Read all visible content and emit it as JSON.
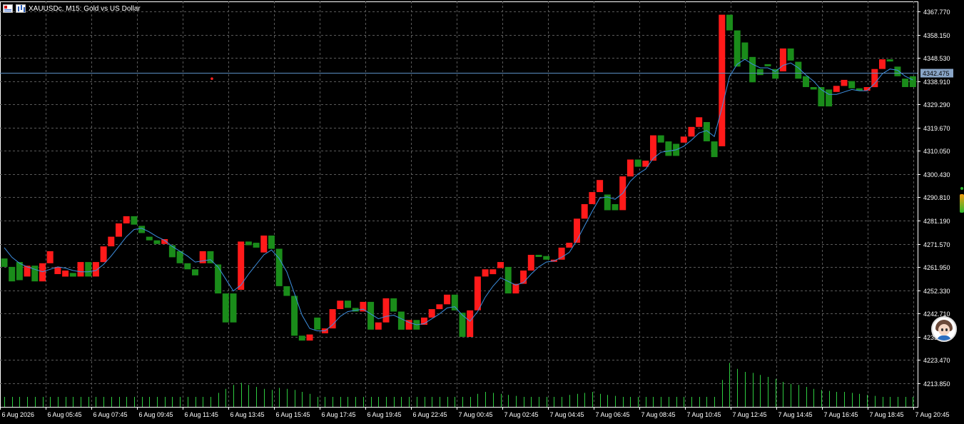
{
  "window": {
    "title": "XAUUSDc, M15:  Gold vs US Dollar"
  },
  "colors": {
    "background": "#000000",
    "grid": "#5a5a5a",
    "bull_candle": "#ff1a1a",
    "bear_candle": "#1a8c1a",
    "ma_line": "#3d8fe0",
    "bid_line": "#5b8fc4",
    "volume": "#2ecc40",
    "axis_text": "#ffffff"
  },
  "chart_data": {
    "type": "bar",
    "symbol": "XAUUSDc",
    "timeframe": "M15",
    "ylim": [
      4204.0,
      4372.0
    ],
    "y_ticks": [
      "4367.770",
      "4358.150",
      "4348.530",
      "4338.910",
      "4329.290",
      "4319.670",
      "4310.050",
      "4300.430",
      "4290.810",
      "4281.190",
      "4271.570",
      "4261.950",
      "4252.330",
      "4242.710",
      "4233.090",
      "4223.470",
      "4213.850"
    ],
    "x_ticks": [
      "6 Aug 2026",
      "6 Aug 05:45",
      "6 Aug 07:45",
      "6 Aug 09:45",
      "6 Aug 11:45",
      "6 Aug 13:45",
      "6 Aug 15:45",
      "6 Aug 17:45",
      "6 Aug 19:45",
      "6 Aug 22:45",
      "7 Aug 00:45",
      "7 Aug 02:45",
      "7 Aug 04:45",
      "7 Aug 06:45",
      "7 Aug 08:45",
      "7 Aug 10:45",
      "7 Aug 12:45",
      "7 Aug 14:45",
      "7 Aug 16:45",
      "7 Aug 18:45",
      "7 Aug 20:45"
    ],
    "current_price": "4342.475",
    "current_price_value": 4342.475,
    "red_marker_price": 4340.0,
    "candles": [
      [
        4265.5,
        4262.0
      ],
      [
        4262.0,
        4256.0
      ],
      [
        4264.0,
        4256.5
      ],
      [
        4258.0,
        4262.5
      ],
      [
        4262.5,
        4256.0
      ],
      [
        4256.0,
        4263.5
      ],
      [
        4263.5,
        4268.5
      ],
      [
        4259.0,
        4262.0
      ],
      [
        4258.0,
        4260.5
      ],
      [
        4259.5,
        4258.0
      ],
      [
        4258.0,
        4264.0
      ],
      [
        4264.0,
        4258.0
      ],
      [
        4258.0,
        4264.0
      ],
      [
        4264.0,
        4270.5
      ],
      [
        4270.5,
        4274.5
      ],
      [
        4274.5,
        4280.0
      ],
      [
        4280.0,
        4283.0
      ],
      [
        4283.0,
        4279.5
      ],
      [
        4279.0,
        4276.0
      ],
      [
        4274.5,
        4273.0
      ],
      [
        4273.0,
        4271.5
      ],
      [
        4271.5,
        4273.5
      ],
      [
        4271.0,
        4266.0
      ],
      [
        4268.5,
        4263.5
      ],
      [
        4263.5,
        4261.0
      ],
      [
        4261.0,
        4258.5
      ],
      [
        4263.5,
        4268.5
      ],
      [
        4268.5,
        4263.5
      ],
      [
        4263.0,
        4251.0
      ],
      [
        4251.0,
        4239.0
      ],
      [
        4251.0,
        4239.0
      ],
      [
        4252.5,
        4272.5
      ],
      [
        4272.5,
        4271.0
      ],
      [
        4272.0,
        4270.0
      ],
      [
        4268.0,
        4275.0
      ],
      [
        4275.0,
        4269.5
      ],
      [
        4269.5,
        4254.0
      ],
      [
        4254.0,
        4250.0
      ],
      [
        4250.0,
        4233.5
      ],
      [
        4233.5,
        4231.5
      ],
      [
        4231.5,
        4234.0
      ],
      [
        4241.0,
        4236.0
      ],
      [
        4234.5,
        4236.5
      ],
      [
        4236.5,
        4244.5
      ],
      [
        4244.5,
        4248.0
      ],
      [
        4248.0,
        4245.0
      ],
      [
        4245.0,
        4243.5
      ],
      [
        4243.5,
        4247.5
      ],
      [
        4247.5,
        4236.0
      ],
      [
        4236.0,
        4239.0
      ],
      [
        4239.0,
        4249.0
      ],
      [
        4249.0,
        4243.5
      ],
      [
        4243.5,
        4236.0
      ],
      [
        4236.0,
        4240.0
      ],
      [
        4240.0,
        4236.0
      ],
      [
        4238.0,
        4241.0
      ],
      [
        4241.0,
        4244.5
      ],
      [
        4244.5,
        4246.5
      ],
      [
        4246.5,
        4250.5
      ],
      [
        4250.5,
        4244.0
      ],
      [
        4243.0,
        4233.0
      ],
      [
        4233.0,
        4244.0
      ],
      [
        4244.0,
        4258.0
      ],
      [
        4258.0,
        4261.0
      ],
      [
        4259.0,
        4261.0
      ],
      [
        4261.5,
        4264.0
      ],
      [
        4262.0,
        4251.0
      ],
      [
        4251.0,
        4255.0
      ],
      [
        4255.0,
        4260.5
      ],
      [
        4260.5,
        4267.0
      ],
      [
        4267.0,
        4266.5
      ],
      [
        4266.5,
        4265.0
      ],
      [
        4265.0,
        4265.0
      ],
      [
        4265.0,
        4270.0
      ],
      [
        4270.0,
        4272.0
      ],
      [
        4272.0,
        4282.0
      ],
      [
        4282.0,
        4288.0
      ],
      [
        4288.0,
        4293.0
      ],
      [
        4293.0,
        4298.0
      ],
      [
        4292.0,
        4285.5
      ],
      [
        4288.0,
        4285.5
      ],
      [
        4285.5,
        4299.5
      ],
      [
        4299.5,
        4306.5
      ],
      [
        4306.5,
        4303.5
      ],
      [
        4303.5,
        4306.0
      ],
      [
        4306.0,
        4316.5
      ],
      [
        4316.5,
        4313.5
      ],
      [
        4314.0,
        4308.0
      ],
      [
        4313.0,
        4308.0
      ],
      [
        4313.5,
        4316.0
      ],
      [
        4316.0,
        4320.0
      ],
      [
        4320.0,
        4324.0
      ],
      [
        4322.0,
        4314.0
      ],
      [
        4314.0,
        4307.5
      ],
      [
        4312.0,
        4366.5
      ],
      [
        4366.5,
        4360.0
      ],
      [
        4360.0,
        4345.0
      ],
      [
        4355.0,
        4348.0
      ],
      [
        4349.0,
        4338.5
      ],
      [
        4344.0,
        4341.5
      ],
      [
        4346.0,
        4345.5
      ],
      [
        4344.0,
        4340.0
      ],
      [
        4343.0,
        4352.5
      ],
      [
        4352.5,
        4347.5
      ],
      [
        4347.0,
        4340.0
      ],
      [
        4341.0,
        4336.5
      ],
      [
        4336.5,
        4335.5
      ],
      [
        4336.5,
        4328.5
      ],
      [
        4335.5,
        4328.5
      ],
      [
        4334.5,
        4337.0
      ],
      [
        4337.0,
        4339.5
      ],
      [
        4339.0,
        4336.0
      ],
      [
        4336.0,
        4335.0
      ],
      [
        4335.0,
        4336.5
      ],
      [
        4336.5,
        4344.0
      ],
      [
        4344.0,
        4348.0
      ],
      [
        4348.0,
        4347.5
      ],
      [
        4345.0,
        4341.0
      ],
      [
        4340.0,
        4336.5
      ],
      [
        4341.0,
        4336.5
      ]
    ],
    "moving_average": [
      4270.0,
      4266.0,
      4263.5,
      4262.0,
      4261.0,
      4260.0,
      4261.0,
      4262.0,
      4261.5,
      4260.5,
      4260.0,
      4260.0,
      4260.5,
      4263.0,
      4266.5,
      4270.5,
      4274.5,
      4277.5,
      4278.0,
      4276.5,
      4274.5,
      4273.0,
      4270.5,
      4268.5,
      4266.5,
      4264.0,
      4264.5,
      4265.0,
      4262.0,
      4257.0,
      4252.0,
      4254.5,
      4259.0,
      4263.0,
      4267.0,
      4269.0,
      4265.5,
      4260.0,
      4251.0,
      4242.0,
      4236.5,
      4235.5,
      4235.5,
      4238.0,
      4241.5,
      4243.5,
      4244.0,
      4244.5,
      4242.5,
      4240.5,
      4241.5,
      4242.0,
      4240.5,
      4239.0,
      4238.0,
      4238.5,
      4240.5,
      4242.5,
      4245.0,
      4245.5,
      4242.0,
      4239.5,
      4243.5,
      4249.5,
      4254.0,
      4257.5,
      4256.0,
      4254.5,
      4255.5,
      4259.0,
      4262.0,
      4264.0,
      4264.5,
      4266.0,
      4268.0,
      4273.0,
      4279.0,
      4285.0,
      4290.5,
      4291.0,
      4290.0,
      4292.5,
      4297.5,
      4300.5,
      4302.5,
      4307.0,
      4309.5,
      4310.0,
      4310.5,
      4312.0,
      4314.5,
      4317.5,
      4318.5,
      4316.0,
      4328.0,
      4341.0,
      4346.0,
      4348.0,
      4346.0,
      4344.5,
      4344.5,
      4343.0,
      4345.5,
      4346.5,
      4344.5,
      4341.5,
      4339.0,
      4335.5,
      4333.5,
      4333.5,
      4334.5,
      4335.5,
      4335.0,
      4335.0,
      4338.0,
      4342.0,
      4344.0,
      4343.5,
      4341.0,
      4339.5
    ],
    "volumes": [
      20,
      20,
      20,
      20,
      20,
      20,
      20,
      20,
      20,
      20,
      20,
      20,
      20,
      20,
      20,
      20,
      20,
      20,
      20,
      20,
      20,
      20,
      20,
      20,
      20,
      20,
      20,
      20,
      28,
      36,
      44,
      48,
      44,
      40,
      36,
      34,
      38,
      36,
      34,
      30,
      26,
      20,
      20,
      20,
      20,
      20,
      20,
      20,
      20,
      20,
      20,
      20,
      20,
      20,
      20,
      20,
      20,
      20,
      20,
      20,
      20,
      20,
      26,
      30,
      28,
      26,
      24,
      22,
      20,
      20,
      20,
      20,
      20,
      20,
      24,
      26,
      28,
      30,
      26,
      24,
      22,
      20,
      20,
      20,
      20,
      20,
      20,
      20,
      20,
      20,
      20,
      20,
      20,
      20,
      54,
      88,
      76,
      70,
      68,
      64,
      60,
      56,
      50,
      46,
      44,
      40,
      36,
      34,
      32,
      30,
      30,
      28,
      26,
      24,
      22,
      20,
      20,
      20,
      20,
      20
    ]
  }
}
